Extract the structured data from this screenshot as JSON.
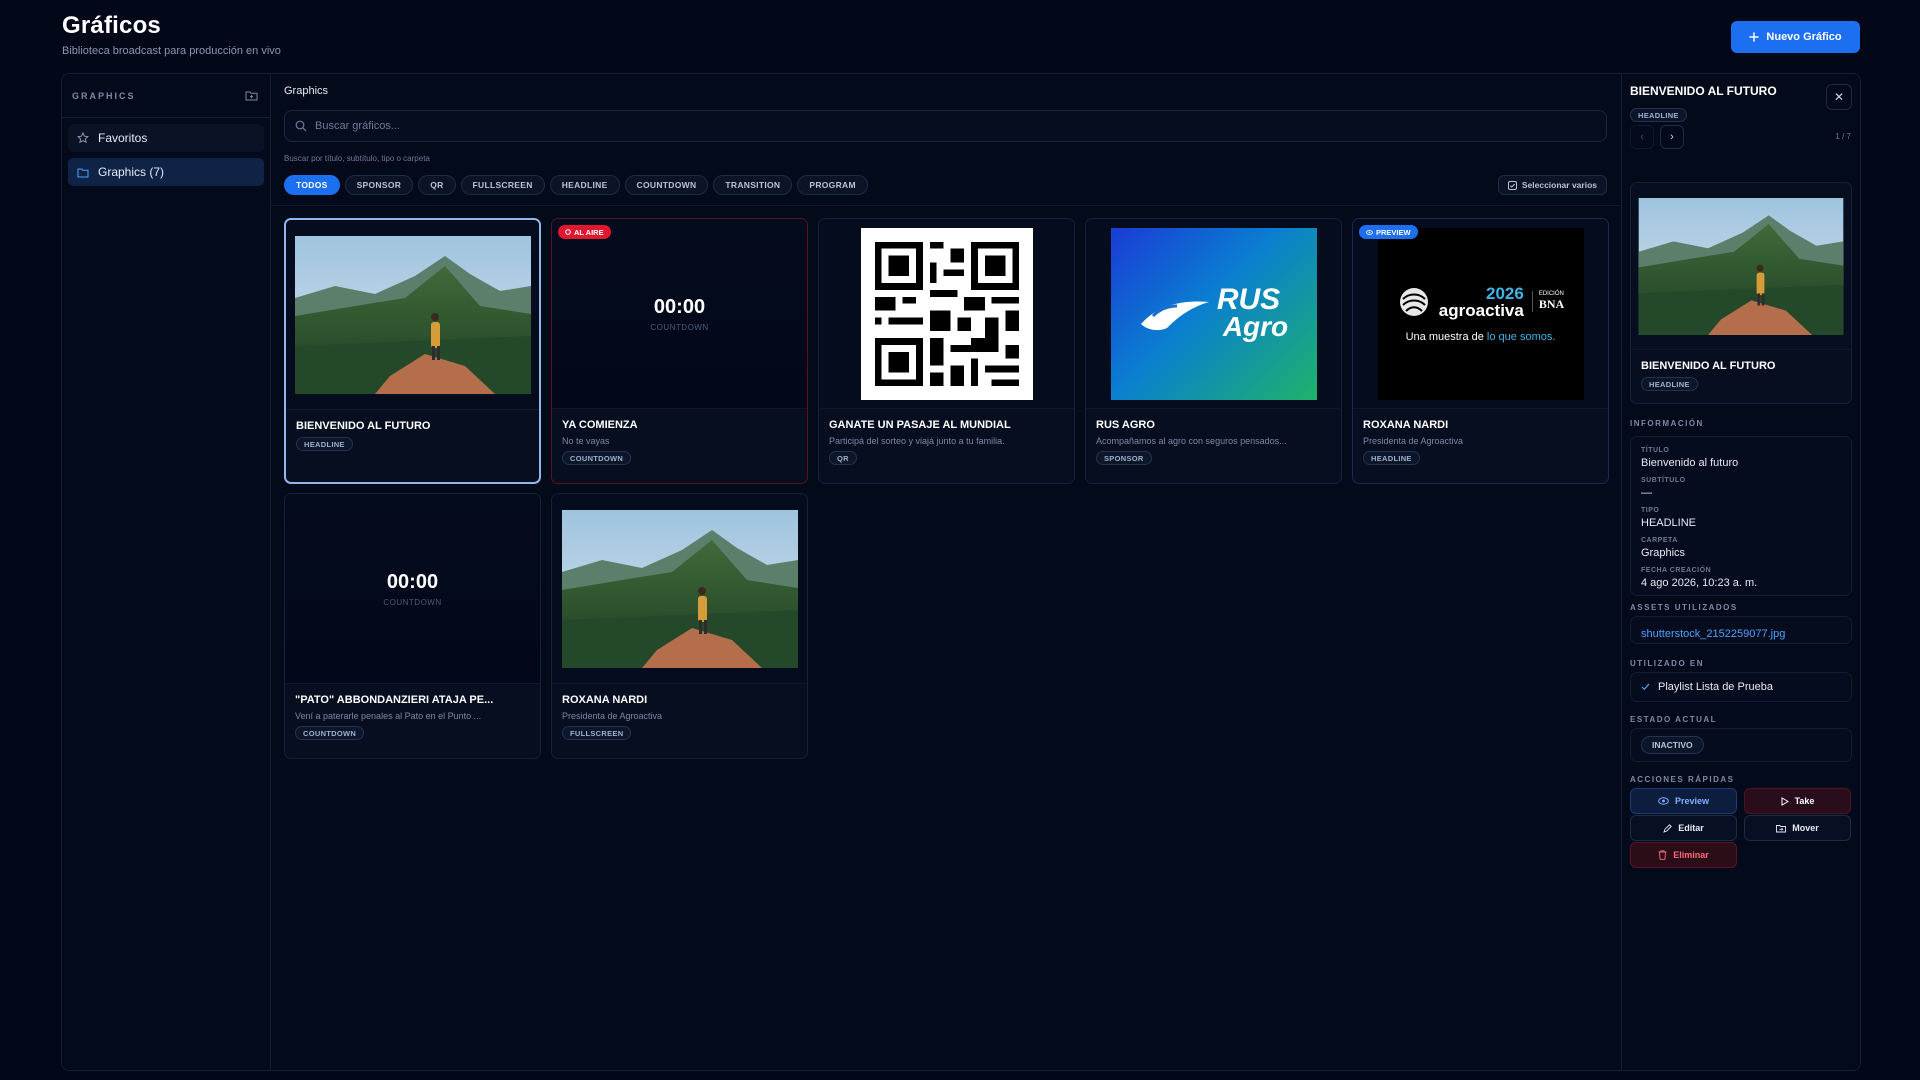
{
  "header": {
    "title": "Gráficos",
    "subtitle": "Biblioteca broadcast para producción en vivo",
    "new_button_label": "Nuevo Gráfico"
  },
  "sidebar": {
    "title": "GRAPHICS",
    "items": [
      {
        "label": "Favoritos",
        "icon": "star-icon",
        "active": false
      },
      {
        "label": "Graphics (7)",
        "icon": "folder-icon",
        "active": true
      }
    ]
  },
  "main": {
    "title": "Graphics",
    "search_placeholder": "Buscar gráficos...",
    "search_hint": "Buscar por título, subtítulo, tipo o carpeta",
    "filters": [
      "TODOS",
      "SPONSOR",
      "QR",
      "FULLSCREEN",
      "HEADLINE",
      "COUNTDOWN",
      "TRANSITION",
      "PROGRAM"
    ],
    "active_filter": "TODOS",
    "select_multiple_label": "Seleccionar varios",
    "cards": [
      {
        "title": "BIENVENIDO AL FUTURO",
        "subtitle": "",
        "type": "HEADLINE",
        "thumb": "photo",
        "state": "selected"
      },
      {
        "title": "YA COMIENZA",
        "subtitle": "No te vayas",
        "type": "COUNTDOWN",
        "thumb": "countdown",
        "countdown": "00:00",
        "countdown_label": "COUNTDOWN",
        "flag": "AL AIRE"
      },
      {
        "title": "GANATE UN PASAJE AL MUNDIAL",
        "subtitle": "Participá del sorteo y viajá junto a tu familia.",
        "type": "QR",
        "thumb": "qr"
      },
      {
        "title": "RUS AGRO",
        "subtitle": "Acompañamos al agro con seguros pensados...",
        "type": "SPONSOR",
        "thumb": "rusagro",
        "logo_text": [
          "RUS",
          "Agro"
        ]
      },
      {
        "title": "ROXANA NARDI",
        "subtitle": "Presidenta de Agroactiva",
        "type": "HEADLINE",
        "thumb": "agroactiva",
        "flag": "PREVIEW",
        "logo": {
          "year": "2026",
          "brand": "agroactiva",
          "edition": "EDICIÓN",
          "bank": "BNA",
          "tagline_a": "Una muestra de ",
          "tagline_b": "lo que somos."
        }
      },
      {
        "title": "\"PATO\" ABBONDANZIERI ATAJA PE...",
        "subtitle": "Vení a paterarle penales al Pato en el Punto ...",
        "type": "COUNTDOWN",
        "thumb": "countdown",
        "countdown": "00:00",
        "countdown_label": "COUNTDOWN"
      },
      {
        "title": "ROXANA NARDI",
        "subtitle": "Presidenta de Agroactiva",
        "type": "FULLSCREEN",
        "thumb": "photo"
      }
    ]
  },
  "panel": {
    "title": "BIENVENIDO AL FUTURO",
    "type_badge": "HEADLINE",
    "counter": "1 / 7",
    "preview_title": "BIENVENIDO AL FUTURO",
    "preview_badge": "HEADLINE",
    "info_label": "INFORMACIÓN",
    "info": [
      {
        "key": "TÍTULO",
        "value": "Bienvenido al futuro"
      },
      {
        "key": "SUBTÍTULO",
        "value": "—"
      },
      {
        "key": "TIPO",
        "value": "HEADLINE"
      },
      {
        "key": "CARPETA",
        "value": "Graphics"
      },
      {
        "key": "FECHA CREACIÓN",
        "value": "4 ago 2026, 10:23 a. m."
      }
    ],
    "assets_label": "ASSETS UTILIZADOS",
    "asset": "shutterstock_2152259077.jpg",
    "used_in_label": "UTILIZADO EN",
    "used_in": "Playlist Lista de Prueba",
    "state_label": "ESTADO ACTUAL",
    "state": "INACTIVO",
    "actions_label": "ACCIONES RÁPIDAS",
    "actions": {
      "preview": "Preview",
      "take": "Take",
      "edit": "Editar",
      "move": "Mover",
      "delete": "Eliminar"
    }
  },
  "colors": {
    "accent": "#1d6ff2",
    "on_air": "#e0182f",
    "background": "#020817"
  }
}
